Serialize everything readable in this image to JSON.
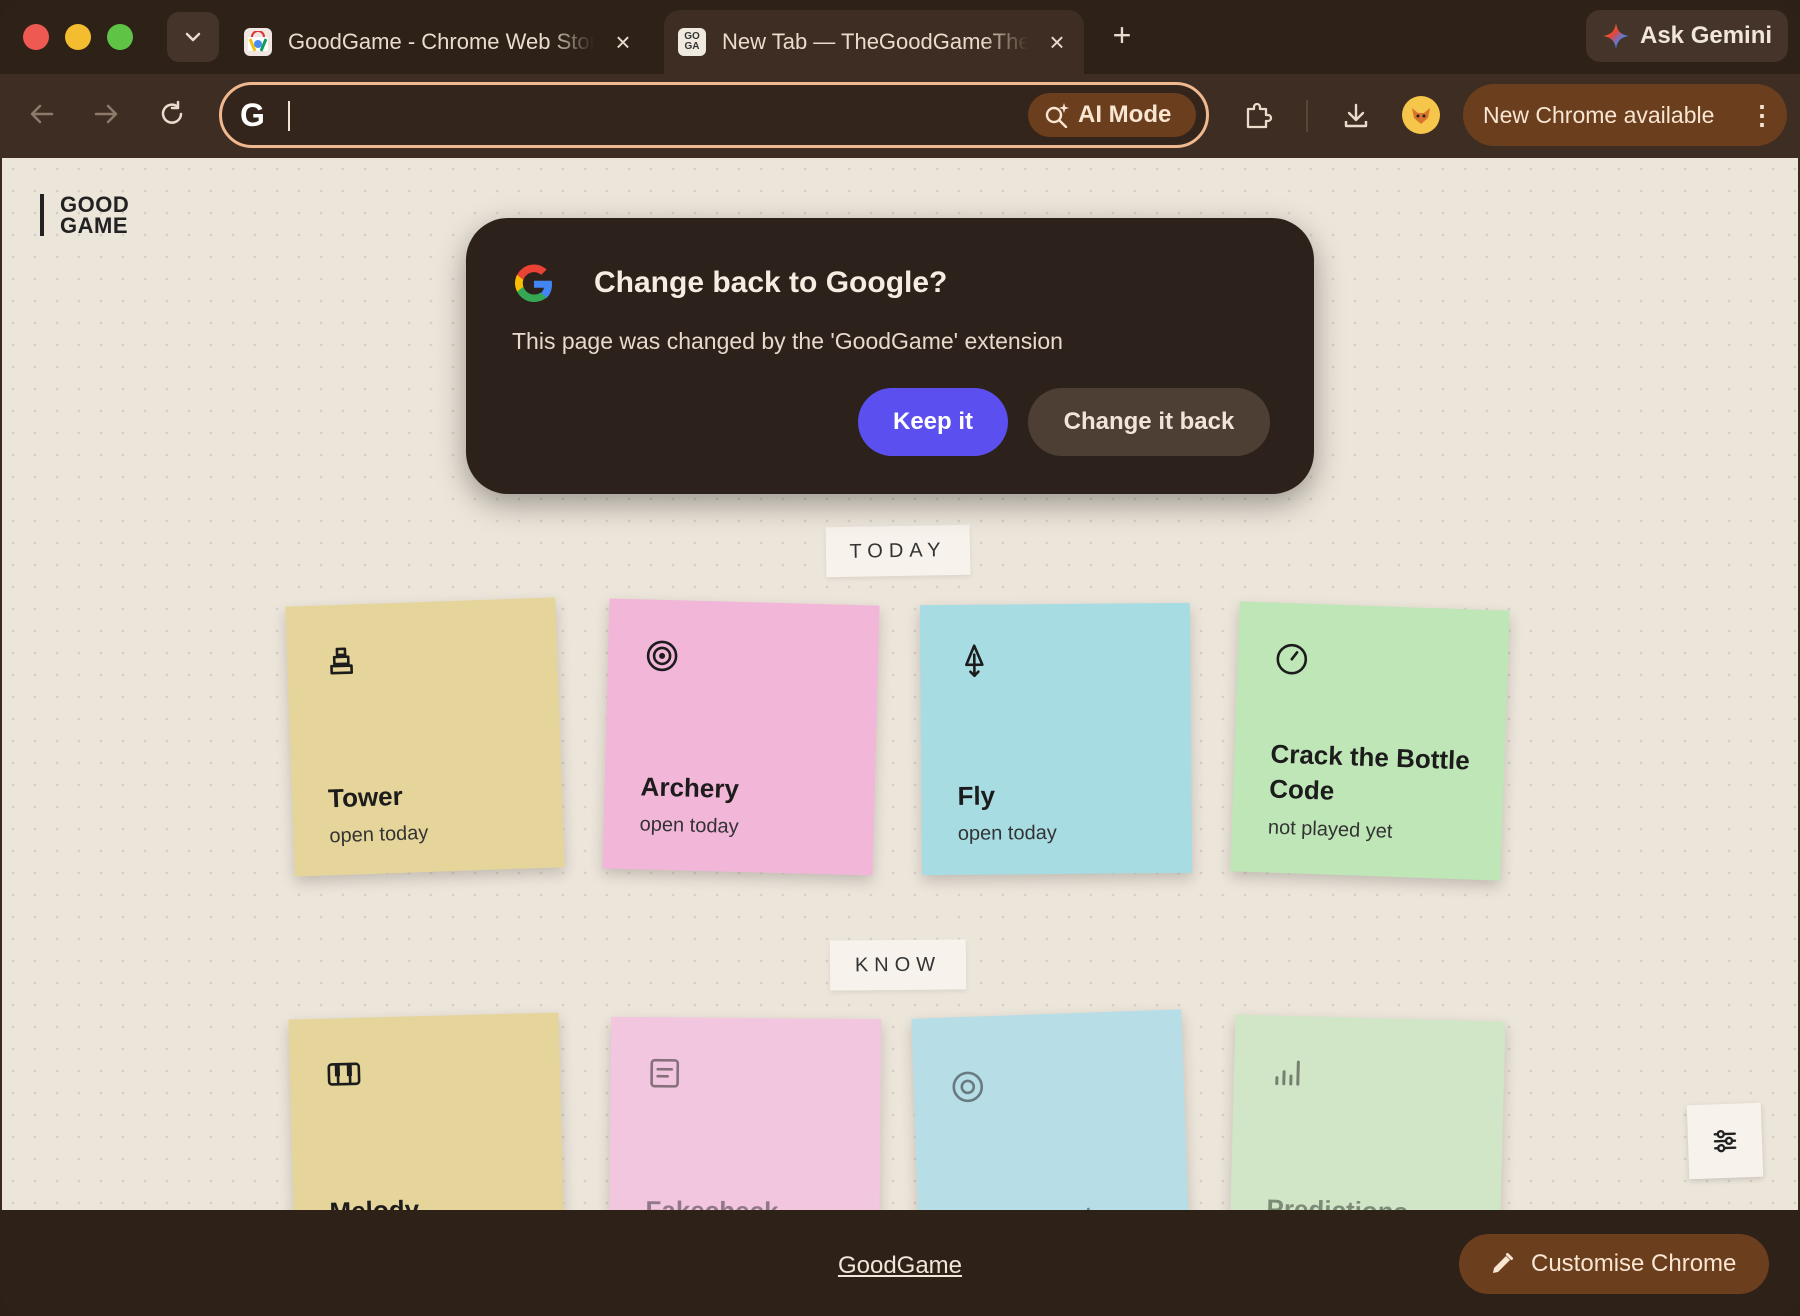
{
  "browser": {
    "tabs": [
      {
        "title": "GoodGame - Chrome Web Store",
        "active": false
      },
      {
        "title": "New Tab — TheGoodGameTheory",
        "active": true,
        "favicon_text": "GO GA"
      }
    ],
    "gemini_label": "Ask Gemini",
    "omnibox": {
      "value": "",
      "ai_mode_label": "AI Mode"
    },
    "update_label": "New Chrome available"
  },
  "page": {
    "logo": {
      "line1": "GOOD",
      "line2": "GAME"
    },
    "dialog": {
      "title": "Change back to Google?",
      "body": "This page was changed by the 'GoodGame' extension",
      "keep_label": "Keep it",
      "change_label": "Change it back"
    },
    "sections": [
      {
        "label": "TODAY",
        "notes": [
          {
            "title": "Tower",
            "status": "open today",
            "icon": "tower-icon",
            "color": "#e6d59a"
          },
          {
            "title": "Archery",
            "status": "open today",
            "icon": "target-icon",
            "color": "#f2b6d8"
          },
          {
            "title": "Fly",
            "status": "open today",
            "icon": "tree-icon",
            "color": "#a7dce3"
          },
          {
            "title": "Crack the Bottle Code",
            "status": "not played yet",
            "icon": "timer-icon",
            "color": "#bfe6b6"
          }
        ]
      },
      {
        "label": "KNOW",
        "notes": [
          {
            "title": "Melody",
            "icon": "piano-icon",
            "color": "#e6d59a"
          },
          {
            "title": "Fakecheck",
            "icon": "document-icon",
            "color": "#f2c6de"
          },
          {
            "title": "Rumorspot",
            "icon": "target-icon",
            "color": "#b7dde6"
          },
          {
            "title": "Predictions",
            "icon": "bar-chart-icon",
            "color": "#d0e6c6"
          }
        ]
      }
    ]
  },
  "footer": {
    "link_label": "GoodGame",
    "customise_label": "Customise Chrome"
  }
}
